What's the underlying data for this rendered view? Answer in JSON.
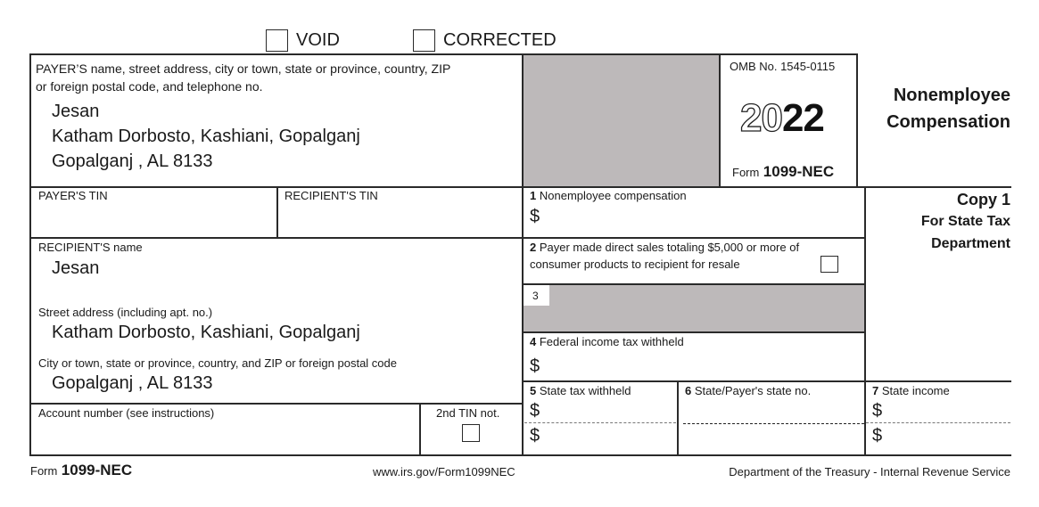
{
  "header": {
    "void_label": "VOID",
    "corrected_label": "CORRECTED",
    "void_checked": false,
    "corrected_checked": false
  },
  "payer": {
    "label_line1": "PAYER’S name, street address, city or town, state or province, country, ZIP",
    "label_line2": "or foreign postal code, and telephone no.",
    "name": "Jesan",
    "street": "Katham Dorbosto, Kashiani, Gopalganj",
    "city": "Gopalganj , AL 8133",
    "tin_label": "PAYER'S TIN",
    "tin_value": ""
  },
  "form_info": {
    "omb": "OMB No. 1545-0115",
    "year_outline": "20",
    "year_solid": "22",
    "form_prefix": "Form",
    "form_name": "1099-NEC",
    "title_line1": "Nonemployee",
    "title_line2": "Compensation",
    "copy_line1": "Copy 1",
    "copy_line2": "For State Tax",
    "copy_line3": "Department"
  },
  "recipient": {
    "tin_label": "RECIPIENT'S TIN",
    "tin_value": "",
    "name_label": "RECIPIENT'S name",
    "name": "Jesan",
    "street_label": "Street address (including apt. no.)",
    "street": "Katham Dorbosto, Kashiani, Gopalganj",
    "city_label": "City or town, state or province, country, and ZIP or foreign postal code",
    "city": "Gopalganj , AL 8133",
    "account_label": "Account number (see instructions)",
    "account_value": "",
    "second_tin_label": "2nd TIN not.",
    "second_tin_checked": false
  },
  "boxes": {
    "box1": {
      "num": "1",
      "label": "Nonemployee compensation",
      "currency": "$",
      "value": ""
    },
    "box2": {
      "num": "2",
      "label_line1": "Payer made direct sales totaling $5,000 or more of",
      "label_line2": "consumer products to recipient for resale",
      "checked": false
    },
    "box3": {
      "num": "3"
    },
    "box4": {
      "num": "4",
      "label": "Federal income tax withheld",
      "currency": "$",
      "value": ""
    },
    "box5": {
      "num": "5",
      "label": "State tax withheld",
      "currency": "$",
      "values": [
        "",
        ""
      ]
    },
    "box6": {
      "num": "6",
      "label": "State/Payer's state no.",
      "values": [
        "",
        ""
      ]
    },
    "box7": {
      "num": "7",
      "label": "State income",
      "currency": "$",
      "values": [
        "",
        ""
      ]
    }
  },
  "footer": {
    "form_prefix": "Form",
    "form_name": "1099-NEC",
    "url": "www.irs.gov/Form1099NEC",
    "agency": "Department of the Treasury - Internal Revenue Service"
  },
  "colors": {
    "shade": "#bdb9ba",
    "border": "#2a2a2a"
  }
}
